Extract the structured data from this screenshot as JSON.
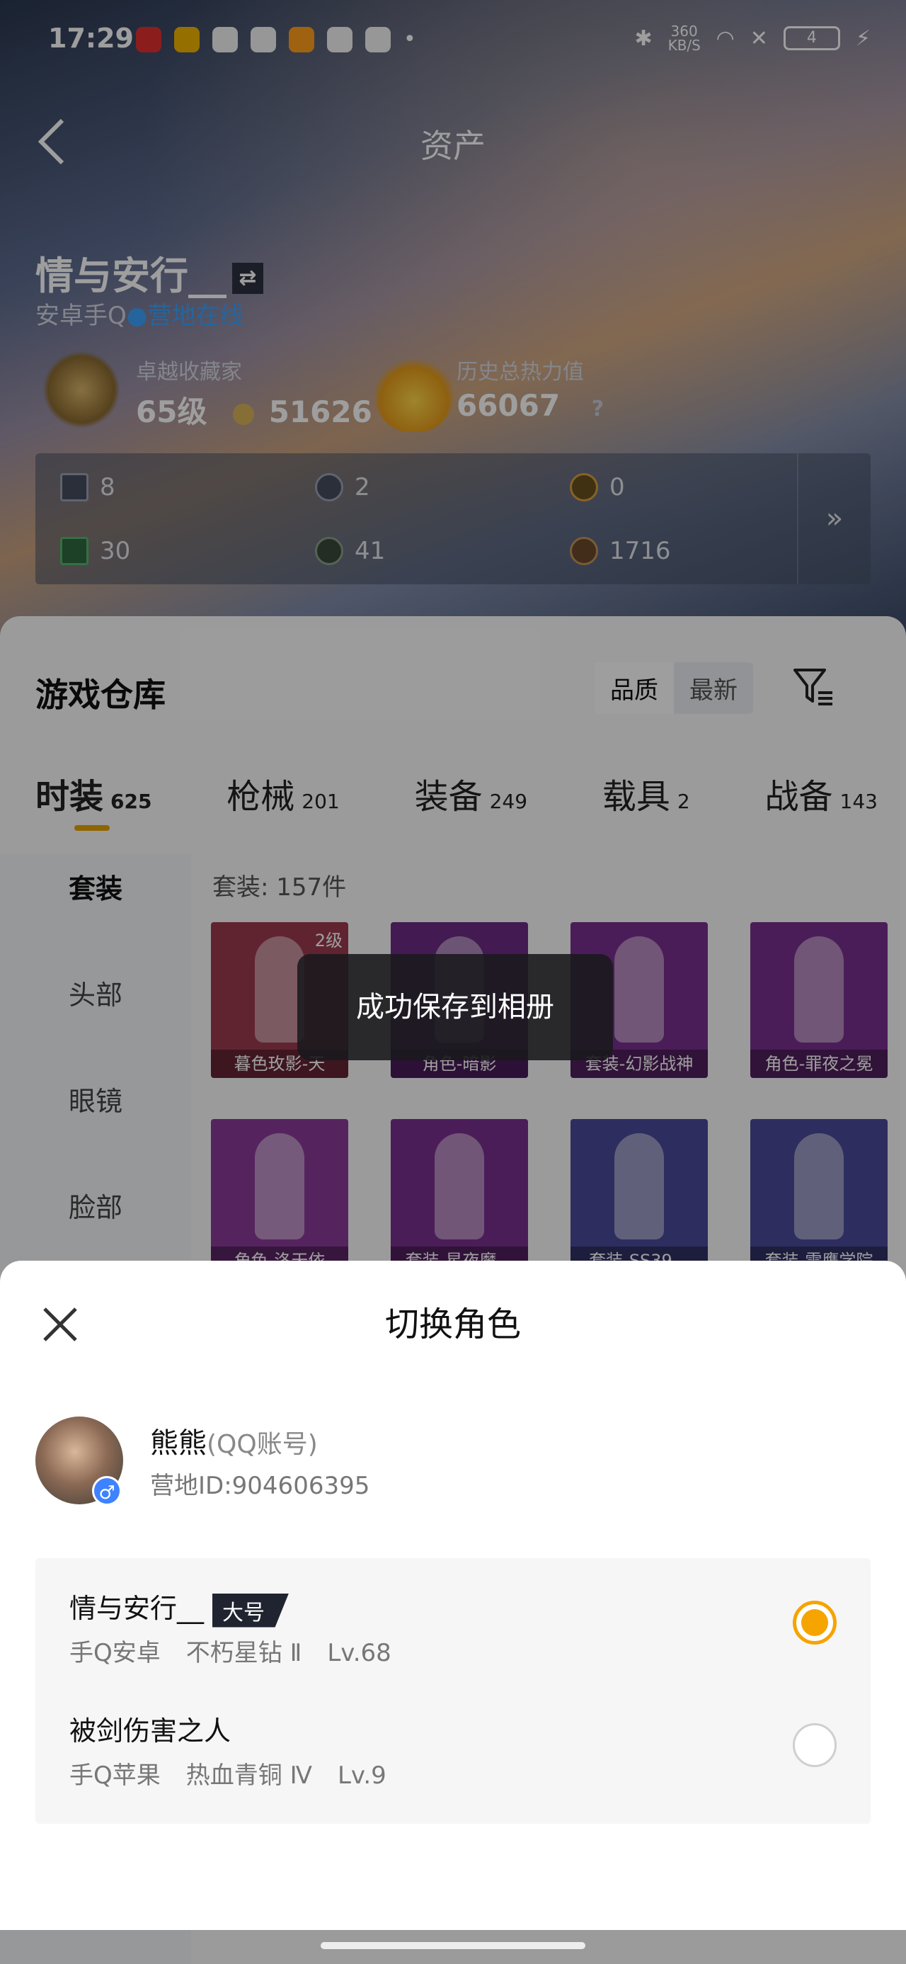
{
  "status_bar": {
    "time": "17:29",
    "network_speed": "360 KB/S",
    "battery": "4",
    "dot": "•",
    "bluetooth_icon": "✱",
    "wifi_icon": "◠",
    "close_icon": "✕",
    "charging_icon": "⚡",
    "app_icon_colors": [
      "#e0312f",
      "#f0b400",
      "#f4f4f4",
      "#f4f4f4",
      "#ff9f1c",
      "#f4f4f4",
      "#f4f4f4"
    ]
  },
  "header": {
    "title": "资产",
    "back_icon": "chevron-left-icon"
  },
  "player": {
    "name": "情与安行__",
    "swap_icon": "⇄",
    "platform": "安卓手Q",
    "online_dot": "●",
    "online_status": "营地在线"
  },
  "stats": {
    "collector_label": "卓越收藏家",
    "collector_level": "65级",
    "collector_points": "51626",
    "heat_label": "历史总热力值",
    "heat_value": "66067",
    "help": "?"
  },
  "resources": {
    "values": [
      "8",
      "2",
      "0",
      "30",
      "41",
      "1716"
    ],
    "more_icon": "»"
  },
  "warehouse": {
    "title": "游戏仓库",
    "sort_options": [
      "品质",
      "最新"
    ],
    "tabs": [
      {
        "label": "时装",
        "count": "625"
      },
      {
        "label": "枪械",
        "count": "201"
      },
      {
        "label": "装备",
        "count": "249"
      },
      {
        "label": "载具",
        "count": "2"
      },
      {
        "label": "战备",
        "count": "143"
      }
    ],
    "categories": [
      "套装",
      "头部",
      "眼镜",
      "脸部"
    ],
    "suit_count": "套装: 157件",
    "items": [
      {
        "caption": "暮色玫影-天",
        "level": "2级",
        "color": "#9c3a50"
      },
      {
        "caption": "角色-暗影",
        "level": "",
        "color": "#6e2a86"
      },
      {
        "caption": "套装-幻影战神",
        "level": "",
        "color": "#7a2f8f"
      },
      {
        "caption": "角色-罪夜之冕",
        "level": "",
        "color": "#7a2f8f"
      },
      {
        "caption": "角色-洛天依",
        "level": "",
        "color": "#8a3a9a"
      },
      {
        "caption": "套装-星夜魔…",
        "level": "",
        "color": "#7a2f8f"
      },
      {
        "caption": "套装-SS39…",
        "level": "",
        "color": "#4a4a9a"
      },
      {
        "caption": "套装-雪鹰学院",
        "level": "",
        "color": "#4a4a9a"
      }
    ]
  },
  "toast": {
    "message": "成功保存到相册"
  },
  "sheet": {
    "title": "切换角色",
    "close_icon": "close-icon",
    "account": {
      "name": "熊熊",
      "type": "(QQ账号)",
      "id": "营地ID:904606395",
      "gender_icon": "♂"
    },
    "roles": [
      {
        "name": "情与安行__",
        "badge": "大号",
        "platform": "手Q安卓",
        "rank": "不朽星钻 Ⅱ",
        "level": "Lv.68",
        "selected": true
      },
      {
        "name": "被剑伤害之人",
        "badge": "",
        "platform": "手Q苹果",
        "rank": "热血青铜 Ⅳ",
        "level": "Lv.9",
        "selected": false
      }
    ]
  }
}
